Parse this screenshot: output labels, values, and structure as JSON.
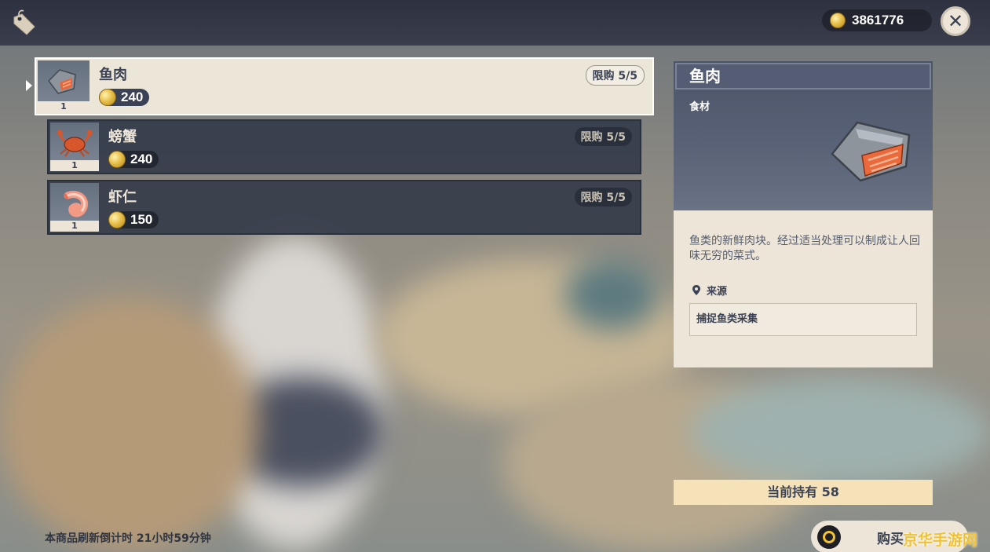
{
  "header": {
    "mora": "3861776",
    "shop_icon": "shop-tag-icon",
    "close_icon": "close-icon"
  },
  "items": [
    {
      "name": "鱼肉",
      "price": "240",
      "limit": "限购 5/5",
      "qty": "1",
      "icon": "fish-meat-icon"
    },
    {
      "name": "螃蟹",
      "price": "240",
      "limit": "限购 5/5",
      "qty": "1",
      "icon": "crab-icon"
    },
    {
      "name": "虾仁",
      "price": "150",
      "limit": "限购 5/5",
      "qty": "1",
      "icon": "shrimp-icon"
    }
  ],
  "detail": {
    "title": "鱼肉",
    "type": "食材",
    "description": "鱼类的新鲜肉块。经过适当处理可以制成让人回味无穷的菜式。",
    "source_label": "来源",
    "source_value": "捕捉鱼类采集"
  },
  "footer": {
    "refresh_text": "本商品刷新倒计时 21小时59分钟",
    "owned_text": "当前持有 58",
    "buy_label": "购买",
    "watermark": "京华手游网"
  },
  "colors": {
    "cream": "#ece5d8",
    "slate": "#3b4255",
    "gold": "#f2c230",
    "owned_bg": "#f6e2b8"
  }
}
